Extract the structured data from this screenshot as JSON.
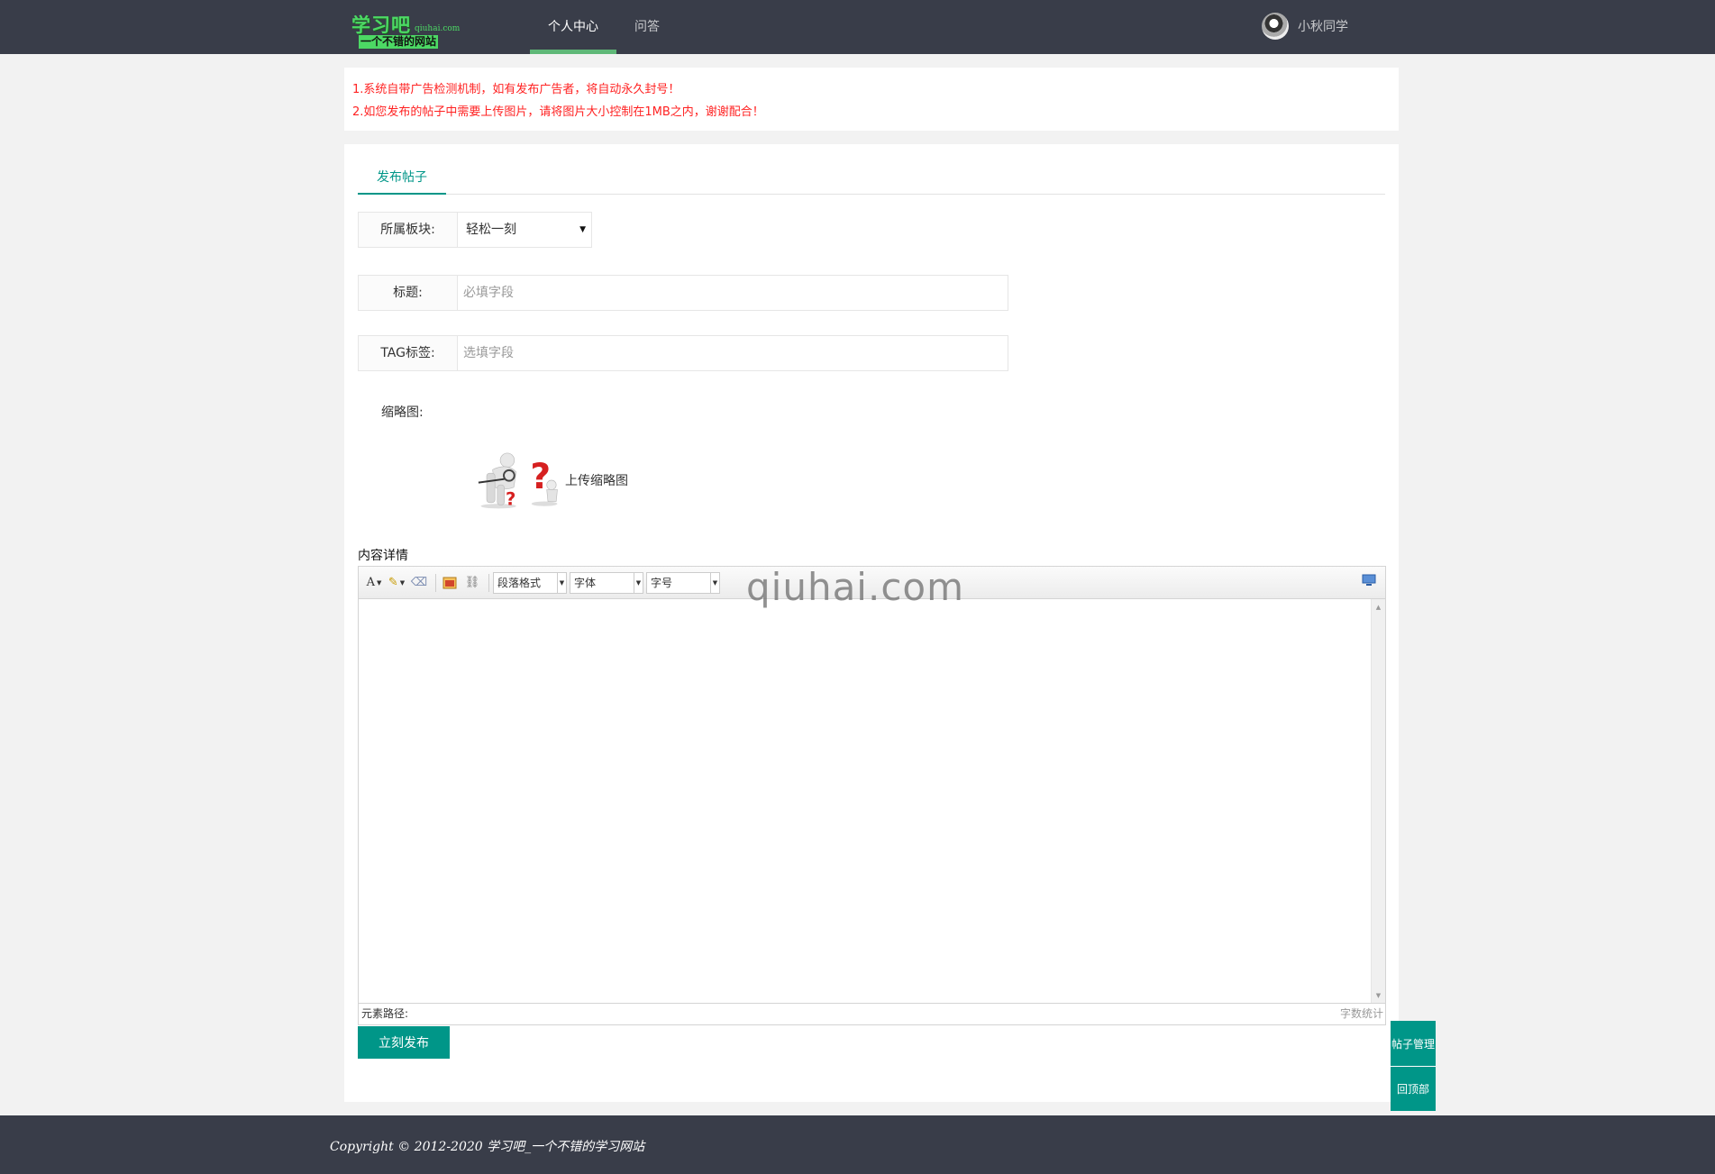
{
  "header": {
    "logo_main": "学习吧",
    "logo_domain": "qiuhai.com",
    "logo_sub": "一个不错的网站",
    "nav": [
      {
        "label": "个人中心"
      },
      {
        "label": "问答"
      }
    ],
    "user_name": "小秋同学"
  },
  "notice": {
    "line1": "1.系统自带广告检测机制，如有发布广告者，将自动永久封号！",
    "line2": "2.如您发布的帖子中需要上传图片，请将图片大小控制在1MB之内，谢谢配合！"
  },
  "form": {
    "tab_label": "发布帖子",
    "category_label": "所属板块:",
    "category_value": "轻松一刻",
    "title_label": "标题:",
    "title_placeholder": "必填字段",
    "tag_label": "TAG标签:",
    "tag_placeholder": "选填字段",
    "thumb_label": "缩略图:",
    "thumb_upload_text": "上传缩略图",
    "content_label": "内容详情",
    "submit_label": "立刻发布"
  },
  "editor": {
    "paragraph_combo": "段落格式",
    "font_combo": "字体",
    "size_combo": "字号",
    "element_path": "元素路径:",
    "word_count": "字数统计",
    "watermark": "qiuhai.com"
  },
  "side": {
    "manage_label": "帖子管理",
    "top_label": "回顶部"
  },
  "footer": {
    "copyright": "Copyright © 2012-2020 学习吧_一个不错的学习网站"
  },
  "colors": {
    "header_bg": "#393d49",
    "accent": "#009688",
    "nav_active": "#5fb878",
    "notice_red": "#ff2222"
  }
}
